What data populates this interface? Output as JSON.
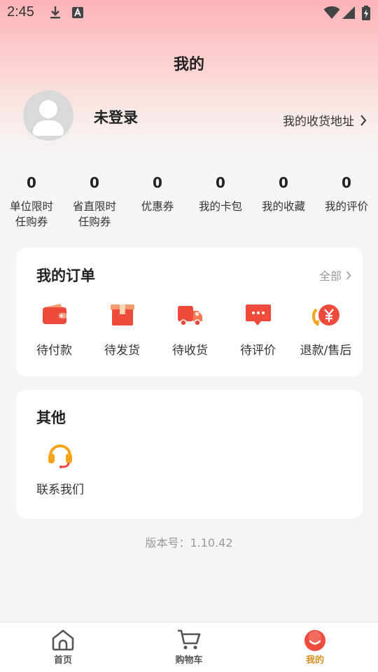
{
  "status_bar": {
    "time": "2:45"
  },
  "header": {
    "title": "我的"
  },
  "profile": {
    "login_status": "未登录",
    "address_link": "我的收货地址"
  },
  "stats": [
    {
      "value": "0",
      "label": "单位限时\n任购券"
    },
    {
      "value": "0",
      "label": "省直限时\n任购券"
    },
    {
      "value": "0",
      "label": "优惠券"
    },
    {
      "value": "0",
      "label": "我的卡包"
    },
    {
      "value": "0",
      "label": "我的收藏"
    },
    {
      "value": "0",
      "label": "我的评价"
    }
  ],
  "orders": {
    "title": "我的订单",
    "view_all": "全部",
    "items": [
      {
        "label": "待付款",
        "icon": "wallet-icon"
      },
      {
        "label": "待发货",
        "icon": "package-icon"
      },
      {
        "label": "待收货",
        "icon": "delivery-truck-icon"
      },
      {
        "label": "待评价",
        "icon": "chat-bubble-icon"
      },
      {
        "label": "退款/售后",
        "icon": "refund-icon"
      }
    ]
  },
  "other": {
    "title": "其他",
    "items": [
      {
        "label": "联系我们",
        "icon": "headset-icon"
      }
    ]
  },
  "version": "版本号：1.10.42",
  "tabbar": {
    "items": [
      {
        "label": "首页",
        "icon": "home-icon"
      },
      {
        "label": "购物车",
        "icon": "cart-icon"
      },
      {
        "label": "我的",
        "icon": "profile-icon",
        "active": true
      }
    ]
  },
  "colors": {
    "accent_red": "#ee4b3c",
    "active_tab": "#d9901f",
    "icon_orange": "#f7a21b"
  }
}
